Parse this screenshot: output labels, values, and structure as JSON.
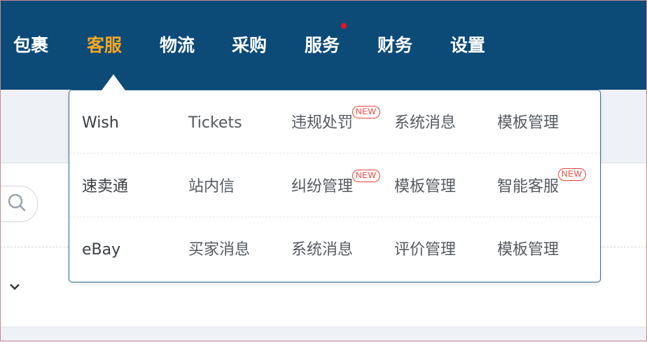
{
  "topnav": {
    "items": [
      {
        "label": "包裹"
      },
      {
        "label": "客服"
      },
      {
        "label": "物流"
      },
      {
        "label": "采购"
      },
      {
        "label": "服务"
      },
      {
        "label": "财务"
      },
      {
        "label": "设置"
      }
    ],
    "active_index": 1,
    "notification_on": "服务",
    "bg_color": "#0c4a78",
    "active_color": "#f5a623"
  },
  "dropdown": {
    "rows": [
      {
        "head": "Wish",
        "items": [
          {
            "label": "Tickets",
            "badge": ""
          },
          {
            "label": "违规处罚",
            "badge": "NEW"
          },
          {
            "label": "系统消息",
            "badge": ""
          },
          {
            "label": "模板管理",
            "badge": ""
          }
        ]
      },
      {
        "head": "速卖通",
        "items": [
          {
            "label": "站内信",
            "badge": ""
          },
          {
            "label": "纠纷管理",
            "badge": "NEW"
          },
          {
            "label": "模板管理",
            "badge": ""
          },
          {
            "label": "智能客服",
            "badge": "NEW"
          }
        ]
      },
      {
        "head": "eBay",
        "items": [
          {
            "label": "买家消息",
            "badge": ""
          },
          {
            "label": "系统消息",
            "badge": ""
          },
          {
            "label": "评价管理",
            "badge": ""
          },
          {
            "label": "模板管理",
            "badge": ""
          }
        ]
      }
    ]
  },
  "icons": {
    "search": "search-icon",
    "chevron": "chevron-down-icon"
  }
}
